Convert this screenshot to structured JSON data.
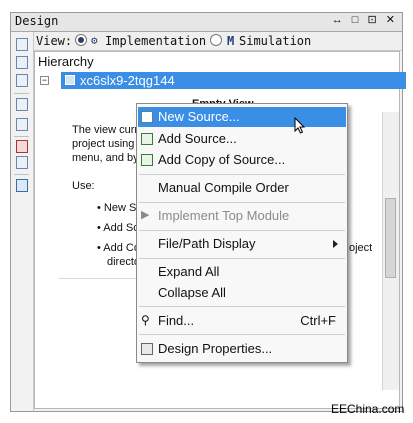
{
  "panel": {
    "title": "Design",
    "controls": "↔ □ ⊡ ✕"
  },
  "viewbar": {
    "label": "View:",
    "implementation": "Implementation",
    "simulation": "Simulation"
  },
  "hierarchy": {
    "label": "Hierarchy",
    "root": "xc6slx9-2tqg144",
    "toggle": "−"
  },
  "doc": {
    "heading": "Empty View",
    "line1": "The view curr",
    "line2": "project using",
    "line3": "menu, and by",
    "use": "Use:",
    "b1": "• New S",
    "b2": "• Add So",
    "b3": "• Add Co",
    "b3b": "directo",
    "tail": "oject"
  },
  "menu": {
    "items": [
      {
        "label": "New Source...",
        "shortcut": ""
      },
      {
        "label": "Add Source...",
        "shortcut": ""
      },
      {
        "label": "Add Copy of Source...",
        "shortcut": ""
      },
      {
        "label": "Manual Compile Order",
        "shortcut": ""
      },
      {
        "label": "Implement Top Module",
        "shortcut": ""
      },
      {
        "label": "File/Path Display",
        "shortcut": ""
      },
      {
        "label": "Expand All",
        "shortcut": ""
      },
      {
        "label": "Collapse All",
        "shortcut": ""
      },
      {
        "label": "Find...",
        "shortcut": "Ctrl+F"
      },
      {
        "label": "Design Properties...",
        "shortcut": ""
      }
    ]
  },
  "watermark": "EEChina.com",
  "colors": {
    "selection": "#3a8ee6",
    "panel_bg": "#f2f2f2"
  }
}
